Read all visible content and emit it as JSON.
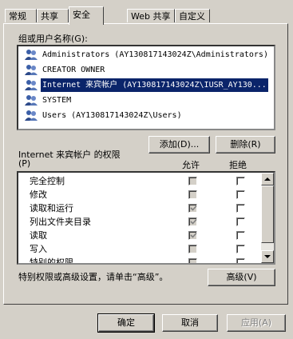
{
  "tabs": [
    "常规",
    "共享",
    "安全",
    "Web 共享",
    "自定义"
  ],
  "active_tab": 2,
  "users_label": "组或用户名称(G):",
  "users": [
    {
      "name": "Administrators (AY130817143024Z\\Administrators)",
      "selected": false
    },
    {
      "name": "CREATOR OWNER",
      "selected": false
    },
    {
      "name": "Internet 来宾帐户 (AY130817143024Z\\IUSR_AY130...",
      "selected": true
    },
    {
      "name": "SYSTEM",
      "selected": false
    },
    {
      "name": "Users (AY130817143024Z\\Users)",
      "selected": false
    }
  ],
  "add_button": "添加(D)...",
  "remove_button": "删除(R)",
  "perm_for_label": "Internet 来宾帐户 的权限",
  "perm_hotkey": "(P)",
  "allow_header": "允许",
  "deny_header": "拒绝",
  "permissions": [
    {
      "name": "完全控制",
      "allow": false,
      "deny": false
    },
    {
      "name": "修改",
      "allow": false,
      "deny": false
    },
    {
      "name": "读取和运行",
      "allow": true,
      "deny": false
    },
    {
      "name": "列出文件夹目录",
      "allow": true,
      "deny": false
    },
    {
      "name": "读取",
      "allow": true,
      "deny": false
    },
    {
      "name": "写入",
      "allow": false,
      "deny": false
    },
    {
      "name": "特别的权限",
      "allow": false,
      "deny": false
    }
  ],
  "advanced_hint": "特别权限或高级设置，请单击“高级”。",
  "advanced_button": "高级(V)",
  "ok_button": "确定",
  "cancel_button": "取消",
  "apply_button": "应用(A)"
}
